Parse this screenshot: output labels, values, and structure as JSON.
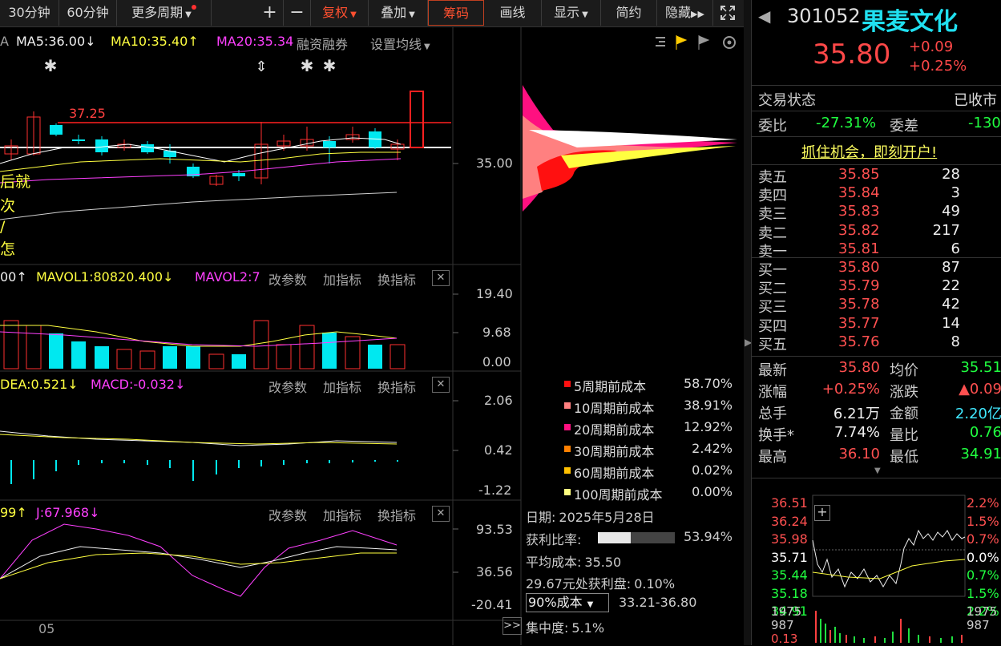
{
  "toolbar": {
    "period_30": "30分钟",
    "period_60": "60分钟",
    "more_periods": "更多周期",
    "plus": "+",
    "minus": "−",
    "fuquan": "复权",
    "diejia": "叠加",
    "chouma": "筹码",
    "huaxian": "画线",
    "xianshi": "显示",
    "jianyue": "简约",
    "yincang": "隐藏"
  },
  "main_chart": {
    "prefix": "A",
    "ma5": "MA5:36.00",
    "ma5_arrow": "↓",
    "ma10": "MA10:35.40",
    "ma10_arrow": "↑",
    "ma20": "MA20:35.34",
    "rzrq": "融资融券",
    "set_ma": "设置均线",
    "price_line_label": "37.25",
    "axis_price": "35.00",
    "left_text_1": "后就",
    "left_text_2": "次",
    "left_text_3": "/",
    "left_text_4": "怎",
    "colors": {
      "up": "#ff3030",
      "down": "#00e8f0",
      "ma5": "#ffffff",
      "ma10": "#ffff40",
      "ma20": "#ff40ff"
    }
  },
  "vol_panel": {
    "prefix": "00",
    "prefix_arrow": "↑",
    "mavol1": "MAVOL1:80820.400",
    "mavol1_arrow": "↓",
    "mavol2": "MAVOL2:7",
    "gcs": "改参数",
    "jzb": "加指标",
    "hzb": "换指标",
    "close": "✕",
    "axis_top": "19.40",
    "axis_mid": "9.68",
    "axis_bot": "0.00"
  },
  "macd_panel": {
    "dea": "DEA:0.521",
    "dea_arrow": "↓",
    "macd": "MACD:-0.032",
    "macd_arrow": "↓",
    "gcs": "改参数",
    "jzb": "加指标",
    "hzb": "换指标",
    "close": "✕",
    "axis_top": "2.06",
    "axis_mid": "0.42",
    "axis_bot": "-1.22"
  },
  "kdj_panel": {
    "prefix": "99",
    "prefix_arrow": "↑",
    "j": "J:67.968",
    "j_arrow": "↓",
    "gcs": "改参数",
    "jzb": "加指标",
    "hzb": "换指标",
    "close": "✕",
    "axis_top": "93.53",
    "axis_mid": "36.56",
    "axis_bot": "-20.41"
  },
  "x_label": "05",
  "cost_legend": [
    {
      "name": "5周期前成本",
      "pct": "58.70%",
      "color": "#ff1010"
    },
    {
      "name": "10周期前成本",
      "pct": "38.91%",
      "color": "#ff8080"
    },
    {
      "name": "20周期前成本",
      "pct": "12.92%",
      "color": "#ff1080"
    },
    {
      "name": "30周期前成本",
      "pct": "2.42%",
      "color": "#ff8000"
    },
    {
      "name": "60周期前成本",
      "pct": "0.02%",
      "color": "#ffc000"
    },
    {
      "name": "100周期前成本",
      "pct": "0.00%",
      "color": "#ffff80"
    }
  ],
  "chip_info": {
    "date_label": "日期:",
    "date": "2025年5月28日",
    "profit_label": "获利比率:",
    "profit": "53.94%",
    "profit_fraction": 0.5394,
    "avg_label": "平均成本:",
    "avg": "35.50",
    "at_price_label": "29.67元处获利盘:",
    "at_price": "0.10%",
    "cost_select": "90%成本",
    "cost_range": "33.21-36.80",
    "conc_label": "集中度:",
    "conc": "5.1%"
  },
  "quote": {
    "code": "301052",
    "name": "果麦文化",
    "price": "35.80",
    "change": "+0.09",
    "change_pct": "+0.25%",
    "status_label": "交易状态",
    "status": "已收市",
    "weibi_label": "委比",
    "weibi": "-27.31%",
    "weicha_label": "委差",
    "weicha": "-130",
    "promo": "抓住机会，即刻开户!",
    "asks": [
      {
        "label": "卖五",
        "price": "35.85",
        "vol": "28"
      },
      {
        "label": "卖四",
        "price": "35.84",
        "vol": "3"
      },
      {
        "label": "卖三",
        "price": "35.83",
        "vol": "49"
      },
      {
        "label": "卖二",
        "price": "35.82",
        "vol": "217"
      },
      {
        "label": "卖一",
        "price": "35.81",
        "vol": "6"
      }
    ],
    "bids": [
      {
        "label": "买一",
        "price": "35.80",
        "vol": "87"
      },
      {
        "label": "买二",
        "price": "35.79",
        "vol": "22"
      },
      {
        "label": "买三",
        "price": "35.78",
        "vol": "42"
      },
      {
        "label": "买四",
        "price": "35.77",
        "vol": "14"
      },
      {
        "label": "买五",
        "price": "35.76",
        "vol": "8"
      }
    ],
    "stats": [
      {
        "l1": "最新",
        "v1": "35.80",
        "c1": "red",
        "l2": "均价",
        "v2": "35.51",
        "c2": "green"
      },
      {
        "l1": "涨幅",
        "v1": "+0.25%",
        "c1": "red",
        "l2": "涨跌",
        "v2": "▲0.09",
        "c2": "red"
      },
      {
        "l1": "总手",
        "v1": "6.21万",
        "c1": "white",
        "l2": "金额",
        "v2": "2.20亿",
        "c2": "cyan"
      },
      {
        "l1": "换手*",
        "v1": "7.74%",
        "c1": "white",
        "l2": "量比",
        "v2": "0.76",
        "c2": "green"
      },
      {
        "l1": "最高",
        "v1": "36.10",
        "c1": "red",
        "l2": "最低",
        "v2": "34.91",
        "c2": "green"
      }
    ]
  },
  "mini_chart": {
    "left_axis": [
      "36.51",
      "36.24",
      "35.98",
      "35.71",
      "35.44",
      "35.18",
      "34.91"
    ],
    "right_axis": [
      "2.2%",
      "1.5%",
      "0.7%",
      "0.0%",
      "0.7%",
      "1.5%",
      "2.2%"
    ],
    "vol_left": [
      "1975",
      "987",
      "0.13"
    ],
    "vol_right": [
      "1975",
      "987"
    ],
    "plus": "+"
  }
}
